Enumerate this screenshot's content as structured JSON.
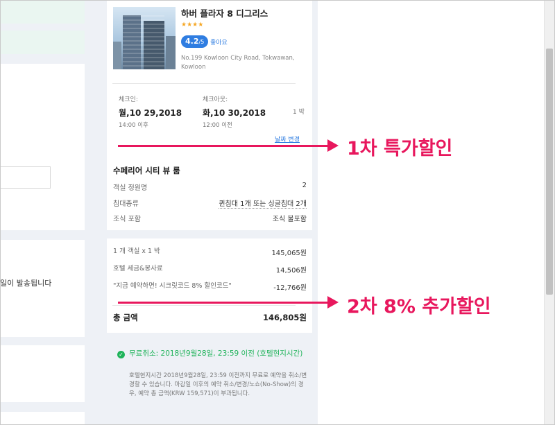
{
  "hotel": {
    "name": "하버 플라자 8 디그리스",
    "stars": "★★★★",
    "rating": "4.2",
    "rating_scale": "/5",
    "rating_text": "좋아요",
    "address": "No.199 Kowloon City Road, Tokwawan, Kowloon"
  },
  "dates": {
    "checkin_label": "체크인:",
    "checkin_date": "월,10 29,2018",
    "checkin_time": "14:00 이후",
    "checkout_label": "체크아웃:",
    "checkout_date": "화,10 30,2018",
    "checkout_time": "12:00 이전",
    "nights": "1 박",
    "change_link": "날짜 변경"
  },
  "room": {
    "title": "수페리어 시티 뷰 룸",
    "rows": [
      {
        "label": "객실 정원명",
        "value": "2"
      },
      {
        "label": "침대종류",
        "value": "퀸침대 1개 또는 싱글침대 2개"
      },
      {
        "label": "조식 포함",
        "value": "조식 불포함"
      }
    ]
  },
  "price": {
    "rows": [
      {
        "label": "1 개 객실 x 1 박",
        "value": "145,065원"
      },
      {
        "label": "호텔 세금&봉사료",
        "value": "14,506원"
      },
      {
        "label": "\"지금 예약하면! 시크릿코드 8% 할인코드\"",
        "value": "-12,766원"
      }
    ],
    "total_label": "총 금액",
    "total_value": "146,805원"
  },
  "cancellation": {
    "title": "무료취소: 2018년9월28일, 23:59 이전 (호텔현지시간)",
    "description": "호텔현지시간 2018년9월28일, 23:59 이전까지 무료로 예약을 취소/변경할 수 있습니다. 마감일 이후의 예약 취소/변경/노쇼(No-Show)의 경우, 예약 총 금액(KRW 159,571)이 부과됩니다."
  },
  "left_notice": "일이 발송됩니다",
  "annotations": {
    "first": "1차 특가할인",
    "second": "2차 8% 추가할인"
  },
  "colors": {
    "accent_blue": "#2f7de1",
    "annotation_pink": "#e8175d",
    "success_green": "#1fb35a",
    "star_orange": "#f5a623"
  }
}
